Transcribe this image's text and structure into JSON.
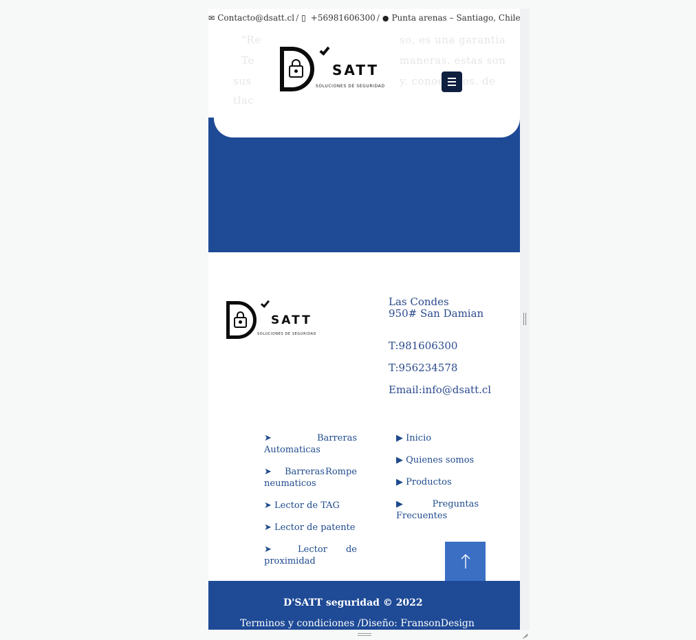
{
  "topbar": {
    "email_icon": "envelope-icon",
    "email": "Contacto@dsatt.cl",
    "sep": "/",
    "phone_icon": "mobile-phone-icon",
    "phone": "+56981606300",
    "location_icon": "map-pin-icon",
    "location": "Punta arenas – Santiago, Chile."
  },
  "header": {
    "logo": {
      "brand": "SATT",
      "tagline": "SOLUCIONES DE SEGURIDAD"
    },
    "menu_icon": "hamburger-icon"
  },
  "footer": {
    "logo": {
      "brand": "SATT",
      "tagline": "SOLUCIONES DE SEGURIDAD"
    },
    "contact": {
      "address_line1": "Las Condes",
      "address_line2": "950# San Damian",
      "phone1": "T:981606300",
      "phone2": "T:956234578",
      "email": "Email:info@dsatt.cl"
    },
    "product_links": [
      {
        "arrow": "➤",
        "first": "Barreras",
        "rest": "Automaticas"
      },
      {
        "arrow": "➤",
        "first": "Barreras Rompe",
        "rest": "neumaticos"
      },
      {
        "arrow": "➤",
        "first": "Lector de TAG",
        "rest": ""
      },
      {
        "arrow": "➤",
        "first": "Lector de patente",
        "rest": ""
      },
      {
        "arrow": "➤",
        "first": "Lector de",
        "rest": "proximidad"
      }
    ],
    "nav_links": [
      {
        "arrow": "▶",
        "first": "Inicio",
        "rest": ""
      },
      {
        "arrow": "▶",
        "first": "Quienes somos",
        "rest": ""
      },
      {
        "arrow": "▶",
        "first": "Productos",
        "rest": ""
      },
      {
        "arrow": "▶",
        "first": "Preguntas",
        "rest": "Frecuentes"
      }
    ],
    "scroll_top_icon": "arrow-up-icon"
  },
  "copyright": {
    "line1": "D'SATT seguridad © 2022",
    "line2": "Terminos y condiciones /Diseño: FransonDesign"
  },
  "colors": {
    "brand_blue": "#1e4a96",
    "link_blue": "#1e4a8c",
    "scroll_button": "#3a6fc4",
    "menu_button": "#0e1f3f"
  }
}
